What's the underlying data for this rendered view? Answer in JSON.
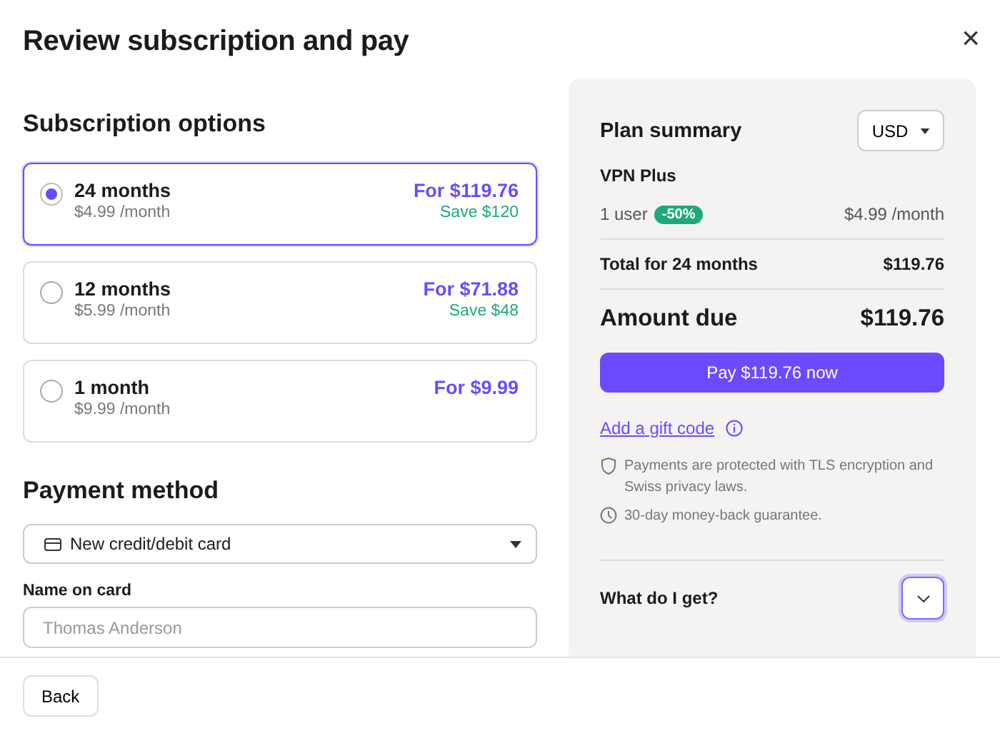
{
  "title": "Review subscription and pay",
  "close": "×",
  "options_heading": "Subscription options",
  "plans": [
    {
      "name": "24 months",
      "per_month": "$4.99 /month",
      "price": "For $119.76",
      "save": "Save $120",
      "selected": true
    },
    {
      "name": "12 months",
      "per_month": "$5.99 /month",
      "price": "For $71.88",
      "save": "Save $48",
      "selected": false
    },
    {
      "name": "1 month",
      "per_month": "$9.99 /month",
      "price": "For $9.99",
      "selected": false
    }
  ],
  "payment_heading": "Payment method",
  "payment_select": {
    "value": "New credit/debit card"
  },
  "name_field": {
    "label": "Name on card",
    "placeholder": "Thomas Anderson"
  },
  "summary": {
    "title": "Plan summary",
    "currency": "USD",
    "product": "VPN Plus",
    "users": "1 user",
    "discount": "-50%",
    "unit_price": "$4.99 /month",
    "total_label": "Total for 24 months",
    "total": "$119.76",
    "due_label": "Amount due",
    "due": "$119.76",
    "pay_button": "Pay $119.76 now",
    "gift_link": "Add a gift code",
    "notes": [
      {
        "kind": "shield",
        "text": "Payments are protected with TLS encryption and Swiss privacy laws."
      },
      {
        "kind": "clock",
        "text": "30-day money-back guarantee."
      }
    ],
    "faq": {
      "question": "What do I get?",
      "expanded": false
    }
  },
  "back_button": "Back"
}
